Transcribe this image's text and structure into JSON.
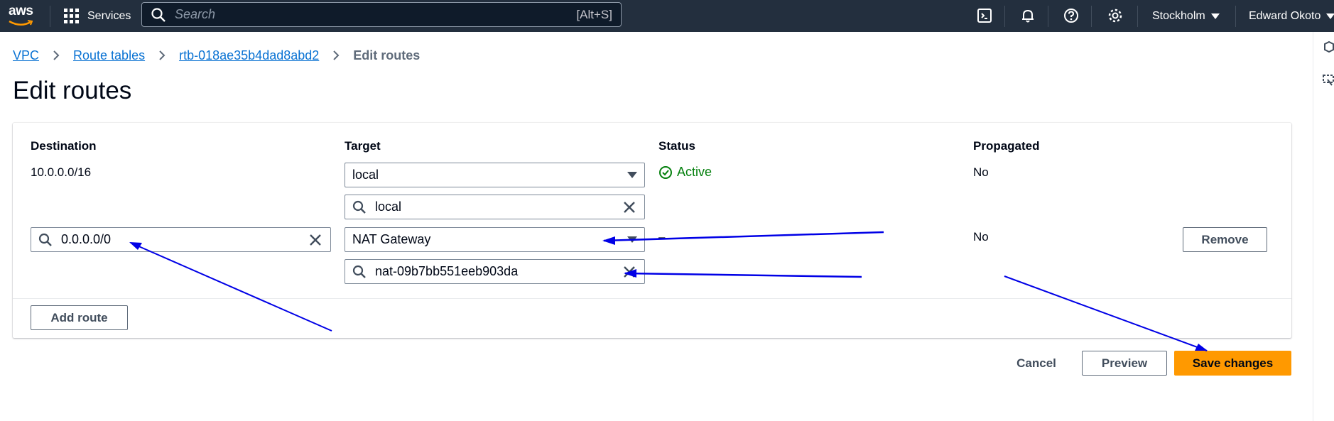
{
  "nav": {
    "logo_text": "aws",
    "services_label": "Services",
    "search_placeholder": "Search",
    "search_shortcut": "[Alt+S]",
    "region_label": "Stockholm",
    "user_label": "Edward Okoto"
  },
  "breadcrumb": {
    "items": [
      "VPC",
      "Route tables",
      "rtb-018ae35b4dad8abd2"
    ],
    "current": "Edit routes"
  },
  "page_title": "Edit routes",
  "table": {
    "headers": {
      "destination": "Destination",
      "target": "Target",
      "status": "Status",
      "propagated": "Propagated"
    },
    "rows": [
      {
        "destination": "10.0.0.0/16",
        "target_type": "local",
        "target_value": "local",
        "status": "Active",
        "propagated": "No"
      },
      {
        "destination": "0.0.0.0/0",
        "target_type": "NAT Gateway",
        "target_value": "nat-09b7bb551eeb903da",
        "status": "–",
        "propagated": "No",
        "remove_label": "Remove"
      }
    ],
    "add_route_label": "Add route"
  },
  "footer": {
    "cancel_label": "Cancel",
    "preview_label": "Preview",
    "save_label": "Save changes"
  },
  "colors": {
    "nav_bg": "#232f3e",
    "primary": "#ff9900",
    "link": "#0972d3",
    "success": "#037f0c",
    "annotation": "#0000e6"
  }
}
